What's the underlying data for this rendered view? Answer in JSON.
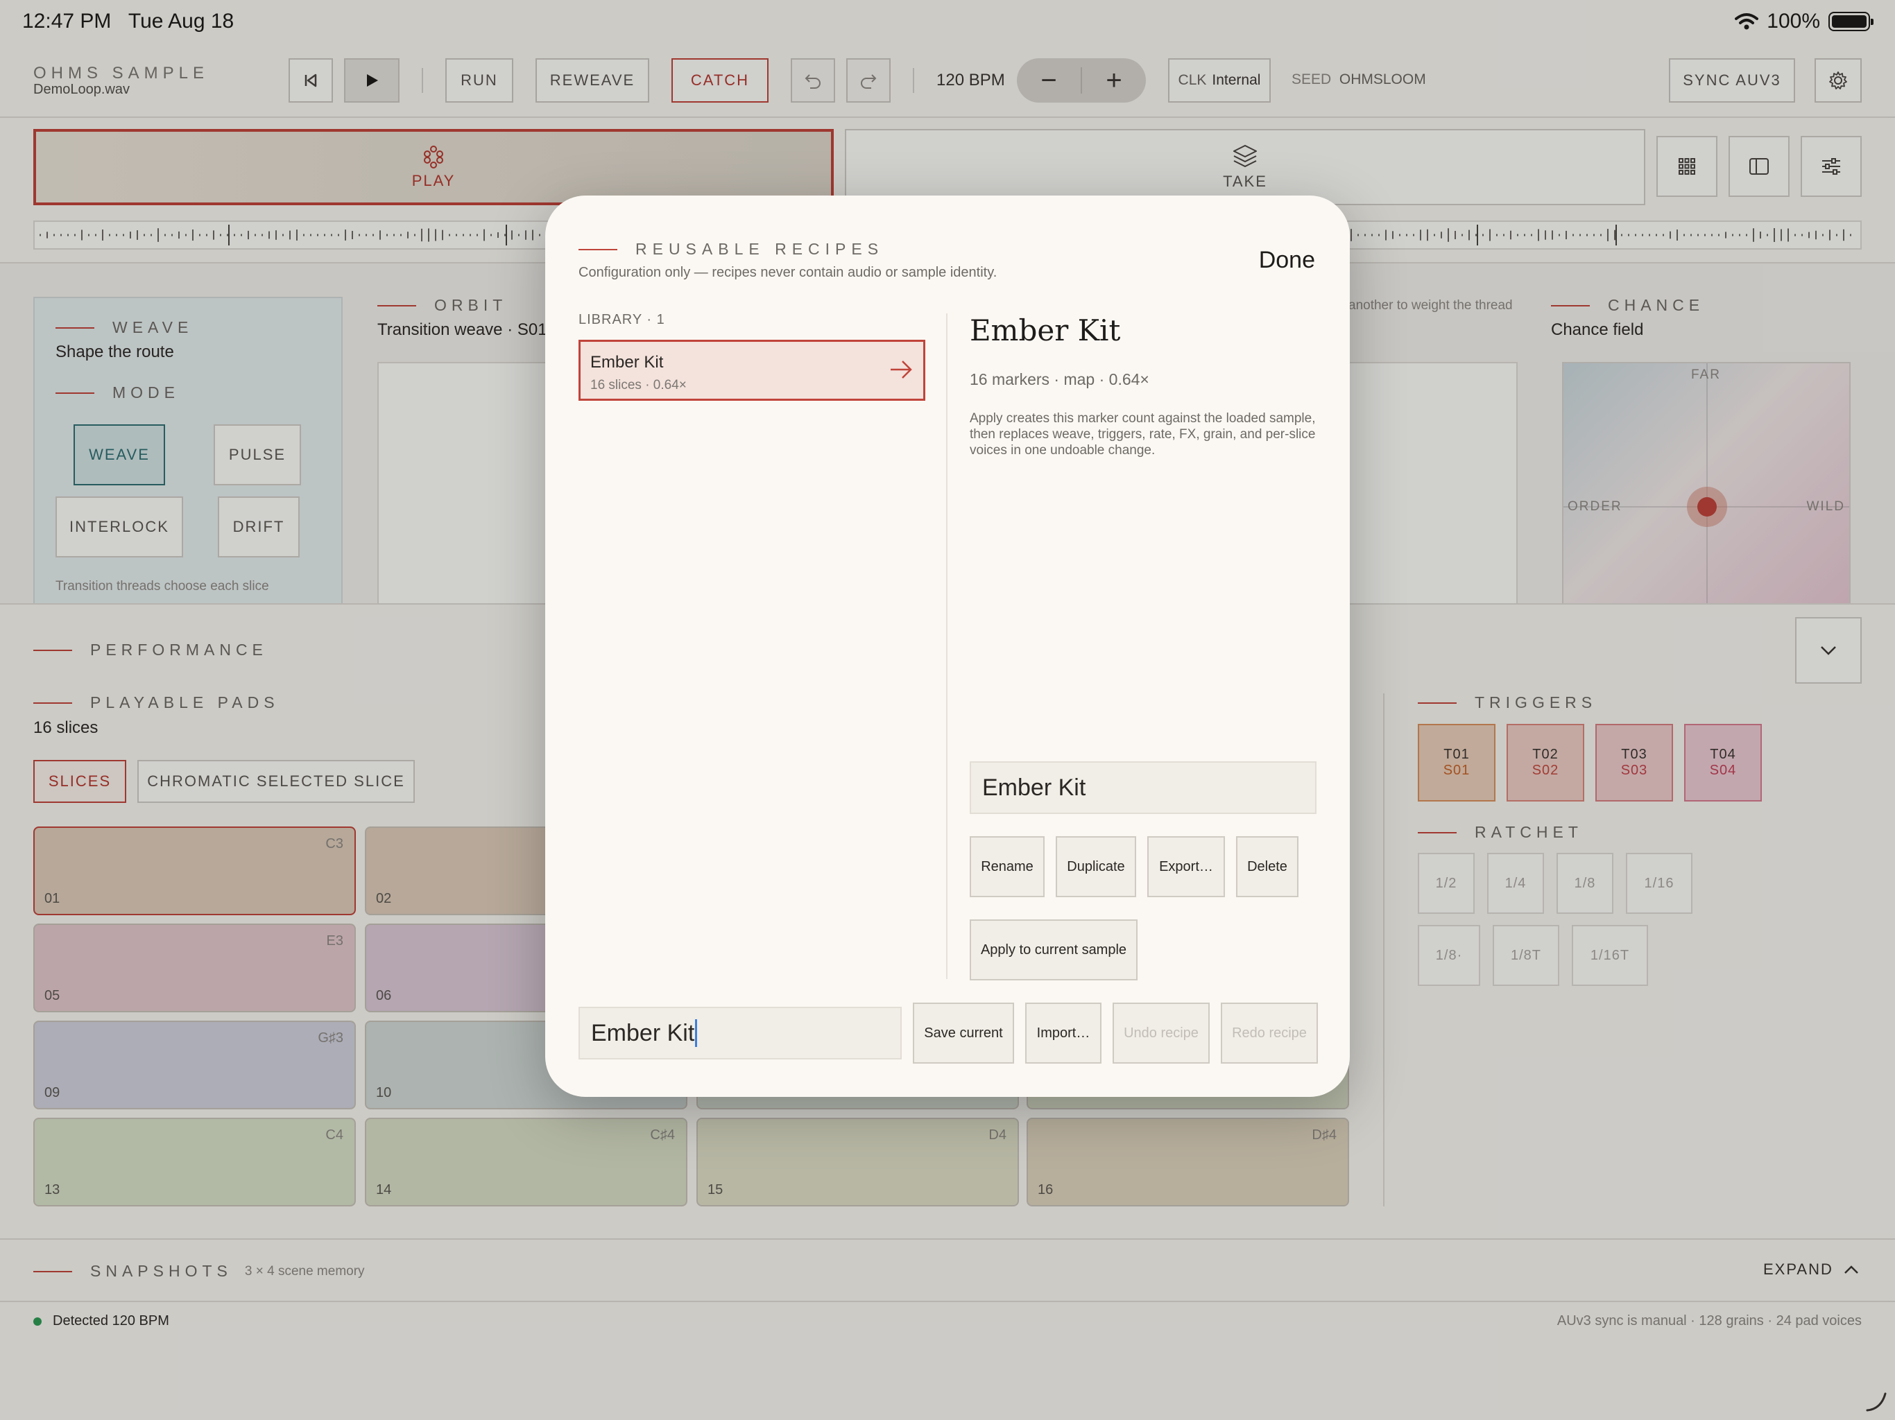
{
  "status_bar": {
    "time": "12:47 PM",
    "date": "Tue Aug 18",
    "battery": "100%",
    "icons": [
      "wifi-icon",
      "battery-icon"
    ]
  },
  "header": {
    "app_title": "OHMS SAMPLE",
    "file_name": "DemoLoop.wav",
    "run": "RUN",
    "reweave": "REWEAVE",
    "catch": "CATCH",
    "bpm": "120 BPM",
    "minus": "−",
    "plus": "+",
    "clk_label": "CLK",
    "clk_value": "Internal",
    "seed_label": "SEED",
    "seed_value": "OHMSLOOM",
    "sync": "SYNC AUV3",
    "icons": [
      "skip-back-icon",
      "play-icon",
      "undo-icon",
      "redo-icon",
      "gear-icon"
    ]
  },
  "modes": {
    "play": "PLAY",
    "take": "TAKE",
    "icons": [
      "play-pattern-icon",
      "layers-icon",
      "grid-icon",
      "sidebar-icon",
      "sliders-icon"
    ]
  },
  "weave": {
    "section": "WEAVE",
    "subtitle": "Shape the route",
    "mode_section": "MODE",
    "buttons": [
      "WEAVE",
      "PULSE",
      "INTERLOCK",
      "DRIFT"
    ],
    "hint": "Transition threads choose each slice"
  },
  "orbit": {
    "section": "ORBIT",
    "subtitle": "Transition weave · S01",
    "hint": "another to weight the thread"
  },
  "chance": {
    "section": "CHANCE",
    "subtitle": "Chance field",
    "far": "FAR",
    "order": "ORDER",
    "wild": "WILD"
  },
  "performance": {
    "section": "PERFORMANCE",
    "pads_section": "PLAYABLE PADS",
    "pads_count": "16 slices",
    "tabs": [
      "SLICES",
      "CHROMATIC SELECTED SLICE"
    ],
    "pads": [
      {
        "num": "01",
        "note": "C3",
        "color": "#dccbb9"
      },
      {
        "num": "02",
        "note": "",
        "color": "#dccbb9"
      },
      {
        "num": "05",
        "note": "E3",
        "color": "#e3c7cc"
      },
      {
        "num": "06",
        "note": "",
        "color": "#dac8d6"
      },
      {
        "num": "09",
        "note": "G♯3",
        "color": "#cfd0dc"
      },
      {
        "num": "10",
        "note": "",
        "color": "#cfd8d4"
      },
      {
        "num": "13",
        "note": "C4",
        "color": "#d7e0c8"
      },
      {
        "num": "14",
        "note": "C♯4",
        "color": "#d6dcc4"
      },
      {
        "num": "15",
        "note": "D4",
        "color": "#dddcc6"
      },
      {
        "num": "16",
        "note": "D♯4",
        "color": "#ddd2bc"
      }
    ],
    "triggers_section": "TRIGGERS",
    "triggers": [
      {
        "t": "T01",
        "s": "S01",
        "color": "#e8cdb8",
        "border": "#d6905c",
        "text": "#c4622a"
      },
      {
        "t": "T02",
        "s": "S02",
        "color": "#ecccc4",
        "border": "#d9857a",
        "text": "#c24a3f"
      },
      {
        "t": "T03",
        "s": "S03",
        "color": "#eccacb",
        "border": "#d77d80",
        "text": "#c2444b"
      },
      {
        "t": "T04",
        "s": "S04",
        "color": "#ebc9d2",
        "border": "#d57b8e",
        "text": "#c2425a"
      }
    ],
    "ratchet_section": "RATCHET",
    "ratchet_row1": [
      "1/2",
      "1/4",
      "1/8",
      "1/16"
    ],
    "ratchet_row2": [
      "1/8·",
      "1/8T",
      "1/16T"
    ]
  },
  "snapshots": {
    "section": "SNAPSHOTS",
    "meta": "3 × 4 scene memory",
    "expand": "EXPAND"
  },
  "footer": {
    "detected": "Detected 120 BPM",
    "info": "AUv3 sync is manual · 128 grains · 24 pad voices"
  },
  "modal": {
    "title": "REUSABLE RECIPES",
    "subtitle": "Configuration only — recipes never contain audio or sample identity.",
    "done": "Done",
    "library_label": "LIBRARY · 1",
    "recipes": [
      {
        "name": "Ember Kit",
        "meta": "16 slices · 0.64×"
      }
    ],
    "detail": {
      "name": "Ember Kit",
      "meta": "16 markers · map · 0.64×",
      "description": "Apply creates this marker count against the loaded sample, then replaces weave, triggers, rate, FX, grain, and per-slice voices in one undoable change.",
      "rename_field": "Ember Kit",
      "buttons": [
        "Rename",
        "Duplicate",
        "Export…",
        "Delete"
      ],
      "apply": "Apply to current sample"
    },
    "save_field": "Ember Kit",
    "bottom_buttons": [
      "Save current",
      "Import…",
      "Undo recipe",
      "Redo recipe"
    ]
  }
}
